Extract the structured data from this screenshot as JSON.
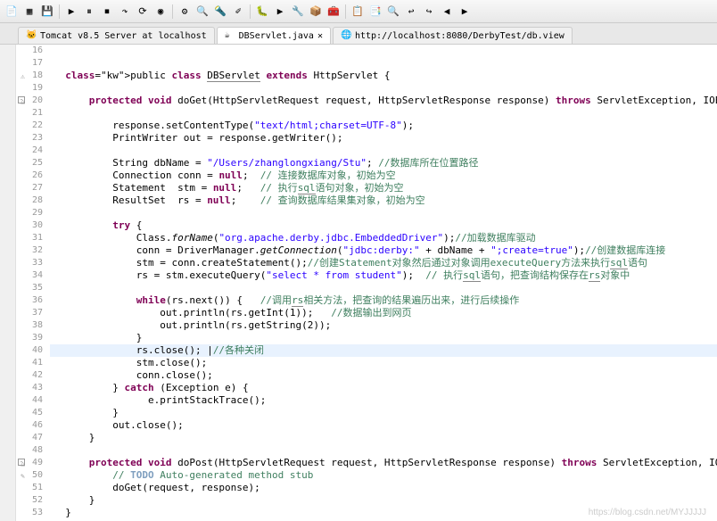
{
  "toolbar_icons": [
    "📄",
    "▦",
    "💾",
    "▶",
    "⏸",
    "⏹",
    "↷",
    "⟳",
    "◉",
    "⚙",
    "🔍",
    "🔦",
    "✐",
    "🐛",
    "▶",
    "🔧",
    "📦",
    "🧰",
    "📋",
    "📑",
    "🔍",
    "↩",
    "↪",
    "◀",
    "▶"
  ],
  "tabs": [
    {
      "icon": "🐱",
      "label": "Tomcat v8.5 Server at localhost",
      "active": false
    },
    {
      "icon": "☕",
      "label": "DBServlet.java",
      "active": true,
      "closable": true,
      "pin": "✕"
    },
    {
      "icon": "🌐",
      "label": "http://localhost:8080/DerbyTest/db.view",
      "active": false
    }
  ],
  "code": [
    {
      "n": 16,
      "t": ""
    },
    {
      "n": 17,
      "t": ""
    },
    {
      "n": 18,
      "t": "  public class DBServlet extends HttpServlet {",
      "k": [
        "public",
        "class",
        "extends"
      ],
      "ty": [
        "DBServlet",
        "HttpServlet"
      ],
      "marker": "warn"
    },
    {
      "n": 19,
      "t": ""
    },
    {
      "n": 20,
      "t": "      protected void doGet(HttpServletRequest request, HttpServletResponse response) throws ServletException, IOException {",
      "k": [
        "protected",
        "void",
        "throws"
      ],
      "fold": true,
      "marker": "over"
    },
    {
      "n": 21,
      "t": ""
    },
    {
      "n": 22,
      "t": "          response.setContentType(\"text/html;charset=UTF-8\");",
      "str": [
        "\"text/html;charset=UTF-8\""
      ]
    },
    {
      "n": 23,
      "t": "          PrintWriter out = response.getWriter();"
    },
    {
      "n": 24,
      "t": ""
    },
    {
      "n": 25,
      "t": "          String dbName = \"/Users/zhanglongxiang/Stu\"; //数据库所在位置路径",
      "str": [
        "\"/Users/zhanglongxiang/Stu\""
      ],
      "cm": "//数据库所在位置路径"
    },
    {
      "n": 26,
      "t": "          Connection conn = null;  // 连接数据库对象，初始为空",
      "k": [
        "null"
      ],
      "cm": "// 连接数据库对象，初始为空"
    },
    {
      "n": 27,
      "t": "          Statement  stm = null;   // 执行sql语句对象，初始为空",
      "k": [
        "null"
      ],
      "cm": "// 执行sql语句对象，初始为空"
    },
    {
      "n": 28,
      "t": "          ResultSet  rs = null;    // 查询数据库结果集对象，初始为空",
      "k": [
        "null"
      ],
      "cm": "// 查询数据库结果集对象，初始为空"
    },
    {
      "n": 29,
      "t": ""
    },
    {
      "n": 30,
      "t": "          try {",
      "k": [
        "try"
      ]
    },
    {
      "n": 31,
      "t": "              Class.forName(\"org.apache.derby.jdbc.EmbeddedDriver\");//加载数据库驱动",
      "str": [
        "\"org.apache.derby.jdbc.EmbeddedDriver\""
      ],
      "cm": "//加载数据库驱动",
      "mth": [
        "forName"
      ]
    },
    {
      "n": 32,
      "t": "              conn = DriverManager.getConnection(\"jdbc:derby:\" + dbName + \";create=true\");//创建数据库连接",
      "str": [
        "\"jdbc:derby:\"",
        "\";create=true\""
      ],
      "cm": "//创建数据库连接",
      "mth": [
        "getConnection"
      ]
    },
    {
      "n": 33,
      "t": "              stm = conn.createStatement();//创建Statement对象然后通过对象调用executeQuery方法来执行sql语句",
      "cm": "//创建Statement对象然后通过对象调用executeQuery方法来执行sql语句"
    },
    {
      "n": 34,
      "t": "              rs = stm.executeQuery(\"select * from student\");  // 执行sql语句，把查询结构保存在rs对象中",
      "str": [
        "\"select * from student\""
      ],
      "cm": "// 执行sql语句，把查询结构保存在rs对象中"
    },
    {
      "n": 35,
      "t": ""
    },
    {
      "n": 36,
      "t": "              while(rs.next()) {   //调用rs相关方法，把查询的结果遍历出来，进行后续操作",
      "k": [
        "while"
      ],
      "cm": "//调用rs相关方法，把查询的结果遍历出来，进行后续操作"
    },
    {
      "n": 37,
      "t": "                  out.println(rs.getInt(1));   //数据输出到网页",
      "cm": "//数据输出到网页"
    },
    {
      "n": 38,
      "t": "                  out.println(rs.getString(2));"
    },
    {
      "n": 39,
      "t": "              }"
    },
    {
      "n": 40,
      "t": "              rs.close(); |//各种关闭",
      "cm": "//各种关闭",
      "hl": true
    },
    {
      "n": 41,
      "t": "              stm.close();"
    },
    {
      "n": 42,
      "t": "              conn.close();"
    },
    {
      "n": 43,
      "t": "          } catch (Exception e) {",
      "k": [
        "catch"
      ]
    },
    {
      "n": 44,
      "t": "                e.printStackTrace();"
    },
    {
      "n": 45,
      "t": "          }"
    },
    {
      "n": 46,
      "t": "          out.close();"
    },
    {
      "n": 47,
      "t": "      }"
    },
    {
      "n": 48,
      "t": ""
    },
    {
      "n": 49,
      "t": "      protected void doPost(HttpServletRequest request, HttpServletResponse response) throws ServletException, IOException {",
      "k": [
        "protected",
        "void",
        "throws"
      ],
      "fold": true,
      "marker": "over"
    },
    {
      "n": 50,
      "t": "          // TODO Auto-generated method stub",
      "todo": true,
      "marker": "todo"
    },
    {
      "n": 51,
      "t": "          doGet(request, response);"
    },
    {
      "n": 52,
      "t": "      }"
    },
    {
      "n": 53,
      "t": "  }"
    }
  ],
  "watermark": "https://blog.csdn.net/MYJJJJJ"
}
